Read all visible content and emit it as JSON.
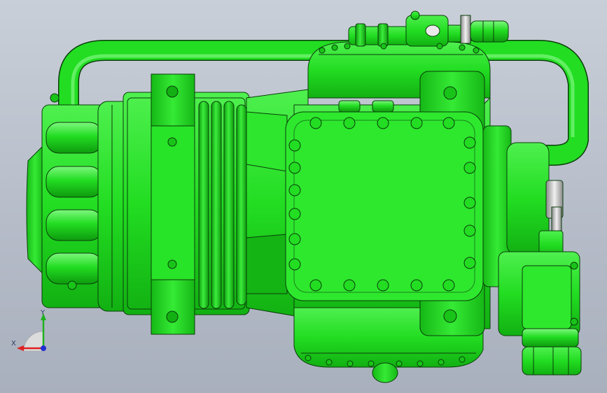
{
  "viewport": {
    "background_top": "#c9cfd8",
    "background_bottom": "#a9b0bd"
  },
  "model": {
    "body_color": "#22dd22",
    "body_light": "#5cf25c",
    "body_dark": "#0fa80f",
    "edge_color": "#0a3d0a",
    "fitting_metal": "#d9d9d9",
    "fitting_dark": "#6a6a6a"
  },
  "triad": {
    "x_label": "X",
    "y_label": "Y",
    "x_color": "#e02020",
    "y_color": "#20b020",
    "origin_color": "#2030d0"
  }
}
